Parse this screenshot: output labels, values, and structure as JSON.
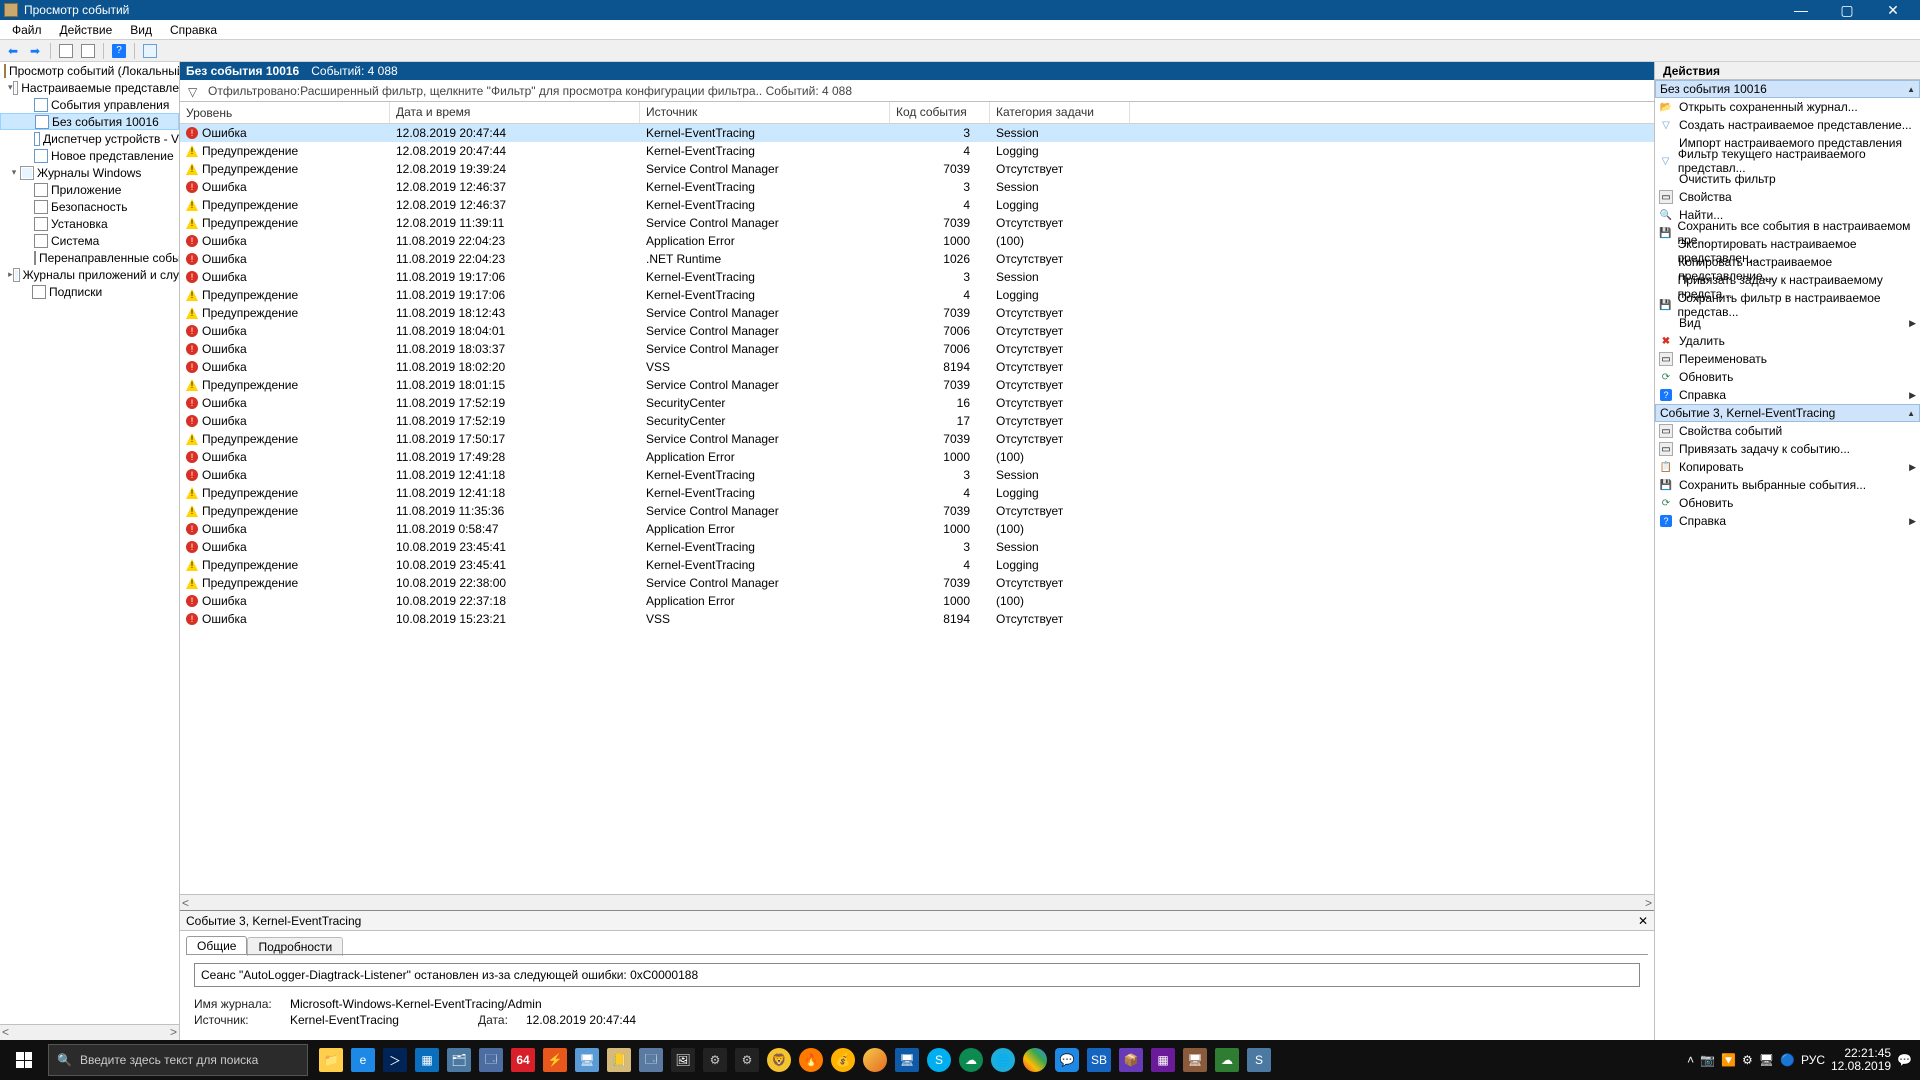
{
  "window": {
    "title": "Просмотр событий"
  },
  "menubar": [
    "Файл",
    "Действие",
    "Вид",
    "Справка"
  ],
  "tree": {
    "root": "Просмотр событий (Локальный",
    "custom_views": "Настраиваемые представле",
    "custom_children": [
      "События управления",
      "Без события 10016",
      "Диспетчер устройств - V",
      "Новое представление"
    ],
    "win_logs": "Журналы Windows",
    "win_children": [
      "Приложение",
      "Безопасность",
      "Установка",
      "Система",
      "Перенаправленные собы"
    ],
    "app_logs": "Журналы приложений и слу",
    "subs": "Подписки"
  },
  "center": {
    "title": "Без события 10016",
    "count_label": "Событий: 4 088",
    "filter_text": "Отфильтровано:Расширенный фильтр, щелкните \"Фильтр\" для просмотра конфигурации фильтра.. Событий: 4 088",
    "columns": [
      "Уровень",
      "Дата и время",
      "Источник",
      "Код события",
      "Категория задачи"
    ]
  },
  "events": [
    {
      "lvl": "e",
      "level": "Ошибка",
      "date": "12.08.2019 20:47:44",
      "src": "Kernel-EventTracing",
      "code": 3,
      "cat": "Session"
    },
    {
      "lvl": "w",
      "level": "Предупреждение",
      "date": "12.08.2019 20:47:44",
      "src": "Kernel-EventTracing",
      "code": 4,
      "cat": "Logging"
    },
    {
      "lvl": "w",
      "level": "Предупреждение",
      "date": "12.08.2019 19:39:24",
      "src": "Service Control Manager",
      "code": 7039,
      "cat": "Отсутствует"
    },
    {
      "lvl": "e",
      "level": "Ошибка",
      "date": "12.08.2019 12:46:37",
      "src": "Kernel-EventTracing",
      "code": 3,
      "cat": "Session"
    },
    {
      "lvl": "w",
      "level": "Предупреждение",
      "date": "12.08.2019 12:46:37",
      "src": "Kernel-EventTracing",
      "code": 4,
      "cat": "Logging"
    },
    {
      "lvl": "w",
      "level": "Предупреждение",
      "date": "12.08.2019 11:39:11",
      "src": "Service Control Manager",
      "code": 7039,
      "cat": "Отсутствует"
    },
    {
      "lvl": "e",
      "level": "Ошибка",
      "date": "11.08.2019 22:04:23",
      "src": "Application Error",
      "code": 1000,
      "cat": "(100)"
    },
    {
      "lvl": "e",
      "level": "Ошибка",
      "date": "11.08.2019 22:04:23",
      "src": ".NET Runtime",
      "code": 1026,
      "cat": "Отсутствует"
    },
    {
      "lvl": "e",
      "level": "Ошибка",
      "date": "11.08.2019 19:17:06",
      "src": "Kernel-EventTracing",
      "code": 3,
      "cat": "Session"
    },
    {
      "lvl": "w",
      "level": "Предупреждение",
      "date": "11.08.2019 19:17:06",
      "src": "Kernel-EventTracing",
      "code": 4,
      "cat": "Logging"
    },
    {
      "lvl": "w",
      "level": "Предупреждение",
      "date": "11.08.2019 18:12:43",
      "src": "Service Control Manager",
      "code": 7039,
      "cat": "Отсутствует"
    },
    {
      "lvl": "e",
      "level": "Ошибка",
      "date": "11.08.2019 18:04:01",
      "src": "Service Control Manager",
      "code": 7006,
      "cat": "Отсутствует"
    },
    {
      "lvl": "e",
      "level": "Ошибка",
      "date": "11.08.2019 18:03:37",
      "src": "Service Control Manager",
      "code": 7006,
      "cat": "Отсутствует"
    },
    {
      "lvl": "e",
      "level": "Ошибка",
      "date": "11.08.2019 18:02:20",
      "src": "VSS",
      "code": 8194,
      "cat": "Отсутствует"
    },
    {
      "lvl": "w",
      "level": "Предупреждение",
      "date": "11.08.2019 18:01:15",
      "src": "Service Control Manager",
      "code": 7039,
      "cat": "Отсутствует"
    },
    {
      "lvl": "e",
      "level": "Ошибка",
      "date": "11.08.2019 17:52:19",
      "src": "SecurityCenter",
      "code": 16,
      "cat": "Отсутствует"
    },
    {
      "lvl": "e",
      "level": "Ошибка",
      "date": "11.08.2019 17:52:19",
      "src": "SecurityCenter",
      "code": 17,
      "cat": "Отсутствует"
    },
    {
      "lvl": "w",
      "level": "Предупреждение",
      "date": "11.08.2019 17:50:17",
      "src": "Service Control Manager",
      "code": 7039,
      "cat": "Отсутствует"
    },
    {
      "lvl": "e",
      "level": "Ошибка",
      "date": "11.08.2019 17:49:28",
      "src": "Application Error",
      "code": 1000,
      "cat": "(100)"
    },
    {
      "lvl": "e",
      "level": "Ошибка",
      "date": "11.08.2019 12:41:18",
      "src": "Kernel-EventTracing",
      "code": 3,
      "cat": "Session"
    },
    {
      "lvl": "w",
      "level": "Предупреждение",
      "date": "11.08.2019 12:41:18",
      "src": "Kernel-EventTracing",
      "code": 4,
      "cat": "Logging"
    },
    {
      "lvl": "w",
      "level": "Предупреждение",
      "date": "11.08.2019 11:35:36",
      "src": "Service Control Manager",
      "code": 7039,
      "cat": "Отсутствует"
    },
    {
      "lvl": "e",
      "level": "Ошибка",
      "date": "11.08.2019 0:58:47",
      "src": "Application Error",
      "code": 1000,
      "cat": "(100)"
    },
    {
      "lvl": "e",
      "level": "Ошибка",
      "date": "10.08.2019 23:45:41",
      "src": "Kernel-EventTracing",
      "code": 3,
      "cat": "Session"
    },
    {
      "lvl": "w",
      "level": "Предупреждение",
      "date": "10.08.2019 23:45:41",
      "src": "Kernel-EventTracing",
      "code": 4,
      "cat": "Logging"
    },
    {
      "lvl": "w",
      "level": "Предупреждение",
      "date": "10.08.2019 22:38:00",
      "src": "Service Control Manager",
      "code": 7039,
      "cat": "Отсутствует"
    },
    {
      "lvl": "e",
      "level": "Ошибка",
      "date": "10.08.2019 22:37:18",
      "src": "Application Error",
      "code": 1000,
      "cat": "(100)"
    },
    {
      "lvl": "e",
      "level": "Ошибка",
      "date": "10.08.2019 15:23:21",
      "src": "VSS",
      "code": 8194,
      "cat": "Отсутствует"
    }
  ],
  "detail": {
    "title": "Событие 3, Kernel-EventTracing",
    "tabs": [
      "Общие",
      "Подробности"
    ],
    "message": "Сеанс \"AutoLogger-Diagtrack-Listener\" остановлен из-за следующей ошибки: 0xC0000188",
    "log_name_label": "Имя журнала:",
    "log_name": "Microsoft-Windows-Kernel-EventTracing/Admin",
    "source_label": "Источник:",
    "source": "Kernel-EventTracing",
    "date_label": "Дата:",
    "date": "12.08.2019 20:47:44"
  },
  "actions": {
    "header": "Действия",
    "section1": "Без события 10016",
    "items1": [
      {
        "icon": "open",
        "label": "Открыть сохраненный журнал..."
      },
      {
        "icon": "create",
        "label": "Создать настраиваемое представление..."
      },
      {
        "icon": "",
        "label": "Импорт настраиваемого представления"
      },
      {
        "icon": "filter",
        "label": "Фильтр текущего настраиваемого представл..."
      },
      {
        "icon": "",
        "label": "Очистить фильтр"
      },
      {
        "icon": "prop",
        "label": "Свойства"
      },
      {
        "icon": "find",
        "label": "Найти..."
      },
      {
        "icon": "save",
        "label": "Сохранить все события в настраиваемом пре..."
      },
      {
        "icon": "",
        "label": "Экспортировать настраиваемое представлен..."
      },
      {
        "icon": "",
        "label": "Копировать настраиваемое представление..."
      },
      {
        "icon": "",
        "label": "Привязать задачу к настраиваемому предста..."
      },
      {
        "icon": "save",
        "label": "Сохранить фильтр в настраиваемое представ..."
      },
      {
        "icon": "",
        "label": "Вид",
        "arrow": true
      },
      {
        "icon": "delete",
        "label": "Удалить"
      },
      {
        "icon": "prop",
        "label": "Переименовать"
      },
      {
        "icon": "refresh",
        "label": "Обновить"
      },
      {
        "icon": "help",
        "label": "Справка",
        "arrow": true
      }
    ],
    "section2": "Событие 3, Kernel-EventTracing",
    "items2": [
      {
        "icon": "prop",
        "label": "Свойства событий"
      },
      {
        "icon": "prop",
        "label": "Привязать задачу к событию..."
      },
      {
        "icon": "copy",
        "label": "Копировать",
        "arrow": true
      },
      {
        "icon": "save",
        "label": "Сохранить выбранные события..."
      },
      {
        "icon": "refresh",
        "label": "Обновить"
      },
      {
        "icon": "help",
        "label": "Справка",
        "arrow": true
      }
    ]
  },
  "taskbar": {
    "search_placeholder": "Введите здесь текст для поиска",
    "time": "22:21:45",
    "date": "12.08.2019",
    "lang": "РУС"
  }
}
